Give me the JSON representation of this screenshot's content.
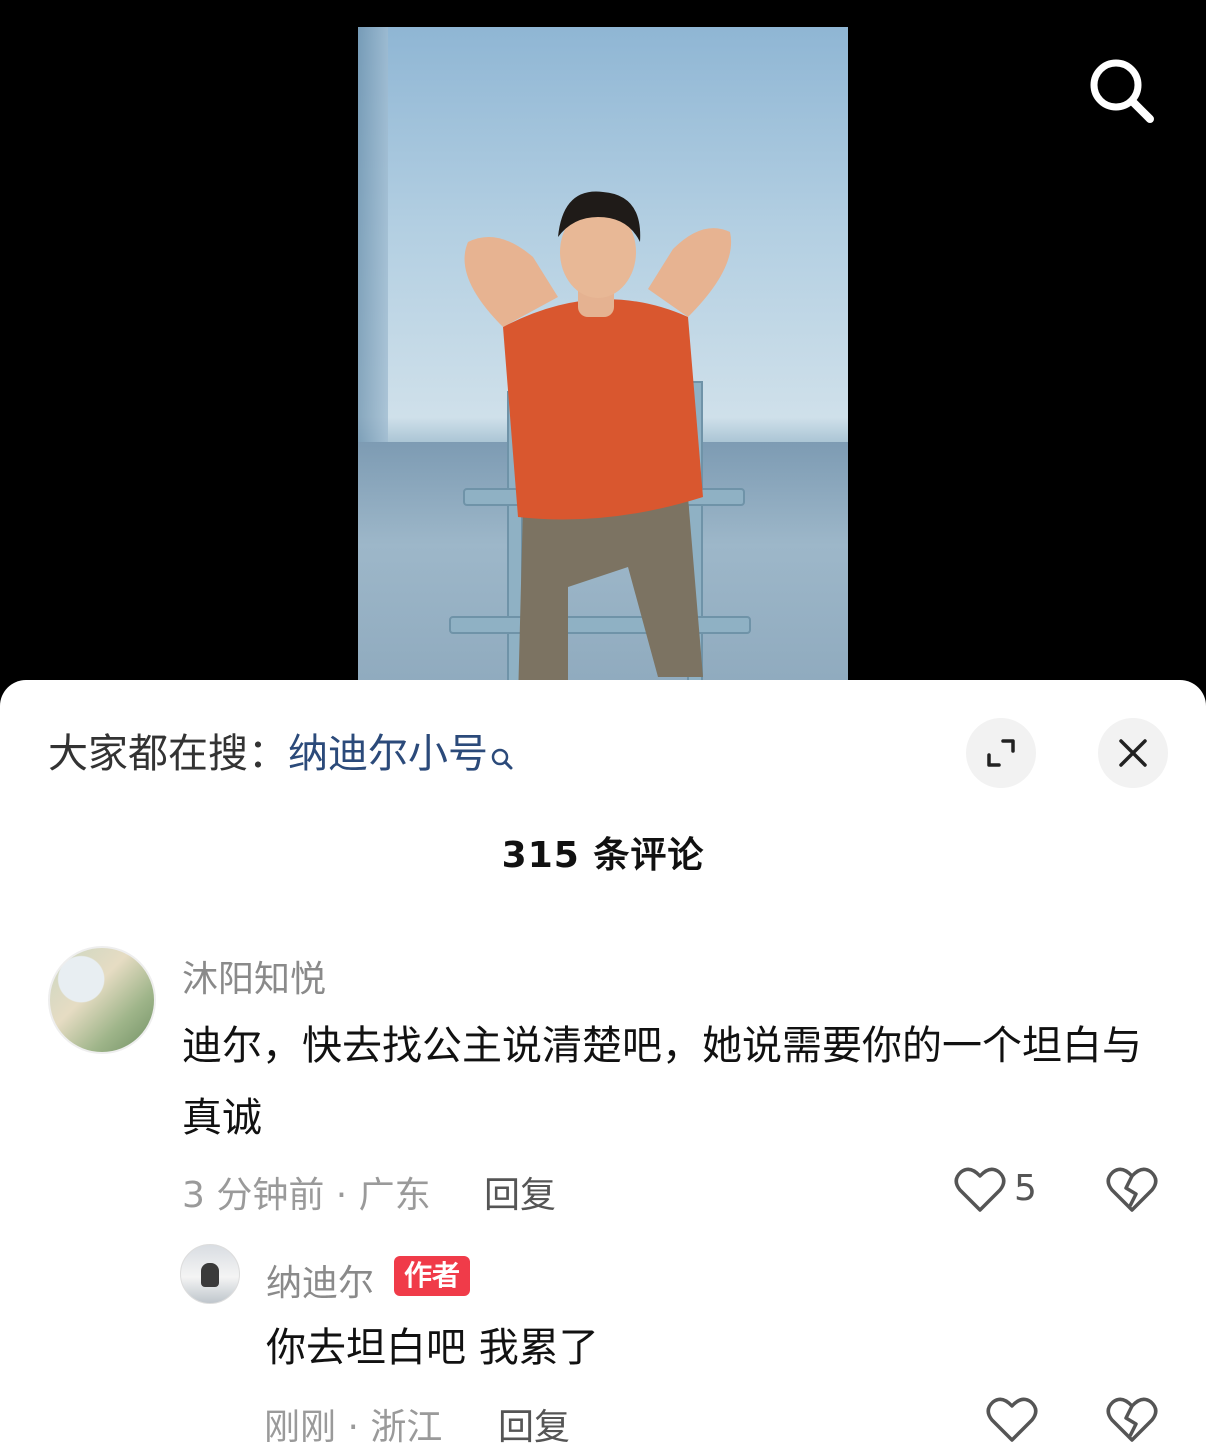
{
  "video": {
    "search_icon": "search-icon"
  },
  "comments_panel": {
    "trending_prefix": "大家都在搜：",
    "trending_keyword": "纳迪尔小号",
    "expand_icon": "expand-icon",
    "close_icon": "close-icon",
    "comment_count_label": "315 条评论",
    "comments": [
      {
        "username": "沐阳知悦",
        "text": "迪尔，快去找公主说清楚吧，她说需要你的一个坦白与真诚",
        "meta": "3 分钟前 · 广东",
        "reply_label": "回复",
        "like_count": "5",
        "replies": [
          {
            "username": "纳迪尔",
            "badge": "作者",
            "text": "你去坦白吧 我累了",
            "meta": "刚刚 · 浙江",
            "reply_label": "回复"
          }
        ]
      }
    ]
  },
  "colors": {
    "author_badge": "#f03b49",
    "keyword": "#2b4a7a",
    "muted_text": "#8a8a8a"
  }
}
